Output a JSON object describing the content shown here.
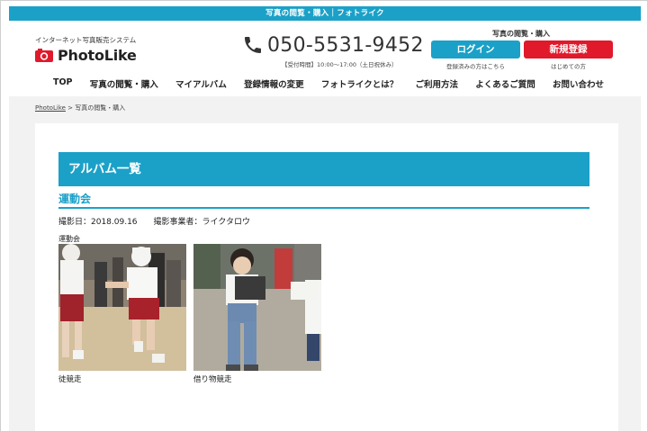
{
  "topbar": {
    "text": "写真の閲覧・購入｜フォトライク"
  },
  "header": {
    "tagline": "インターネット写真販売システム",
    "logo_text": "PhotoLike",
    "phone_number": "050-5531-9452",
    "hours": "【受付時間】10:00〜17:00（土日祝休み）",
    "gallery_caption": "写真の閲覧・購入",
    "login_label": "ログイン",
    "login_note": "登録済みの方はこちら",
    "register_label": "新規登録",
    "register_note": "はじめての方",
    "brand_color": "#1ba1c8",
    "register_color": "#e0192b"
  },
  "nav": {
    "items": [
      "TOP",
      "写真の閲覧・購入",
      "マイアルバム",
      "登録情報の変更",
      "フォトライクとは？",
      "ご利用方法",
      "よくあるご質問",
      "お問い合わせ"
    ]
  },
  "breadcrumb": {
    "home": "PhotoLike",
    "separator": " > ",
    "current": "写真の閲覧・購入"
  },
  "album": {
    "heading": "アルバム一覧",
    "event_title": "運動会",
    "date_label": "撮影日：2018.09.16",
    "photographer_label": "撮影事業者：ライクタロウ",
    "album_name": "運動会",
    "photos": [
      {
        "caption": "徒競走"
      },
      {
        "caption": "借り物競走"
      }
    ]
  }
}
